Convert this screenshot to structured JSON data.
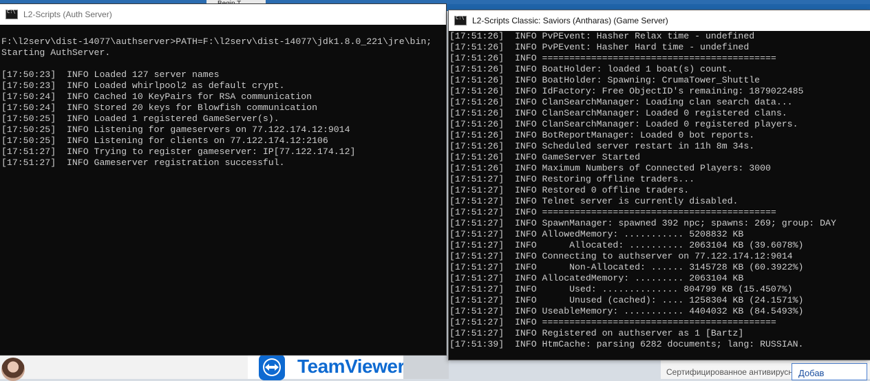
{
  "background": {
    "tab_label": "Begin T",
    "teamviewer_name": "TeamViewer",
    "antivirus_caption": "Сертифицированное антивирусное решение",
    "antivirus_button": "Добав"
  },
  "auth_window": {
    "title": "L2-Scripts (Auth Server)",
    "header_lines": [
      "F:\\l2serv\\dist-14077\\authserver>PATH=F:\\l2serv\\dist-14077\\jdk1.8.0_221\\jre\\bin;",
      "Starting AuthServer."
    ],
    "log_lines": [
      "[17:50:23]  INFO Loaded 127 server names",
      "[17:50:23]  INFO Loaded whirlpool2 as default crypt.",
      "[17:50:24]  INFO Cached 10 KeyPairs for RSA communication",
      "[17:50:24]  INFO Stored 20 keys for Blowfish communication",
      "[17:50:25]  INFO Loaded 1 registered GameServer(s).",
      "[17:50:25]  INFO Listening for gameservers on 77.122.174.12:9014",
      "[17:50:25]  INFO Listening for clients on 77.122.174.12:2106",
      "[17:51:27]  INFO Trying to register gameserver: IP[77.122.174.12]",
      "[17:51:27]  INFO Gameserver registration successful."
    ]
  },
  "game_window": {
    "title": "L2-Scripts Classic: Saviors (Antharas) (Game Server)",
    "log_lines": [
      "[17:51:26]  INFO PvPEvent: Hasher Relax time - undefined",
      "[17:51:26]  INFO PvPEvent: Hasher Hard time - undefined",
      "[17:51:26]  INFO ===========================================",
      "[17:51:26]  INFO BoatHolder: loaded 1 boat(s) count.",
      "[17:51:26]  INFO BoatHolder: Spawning: CrumaTower_Shuttle",
      "[17:51:26]  INFO IdFactory: Free ObjectID's remaining: 1879022485",
      "[17:51:26]  INFO ClanSearchManager: Loading clan search data...",
      "[17:51:26]  INFO ClanSearchManager: Loaded 0 registered clans.",
      "[17:51:26]  INFO ClanSearchManager: Loaded 0 registered players.",
      "[17:51:26]  INFO BotReportManager: Loaded 0 bot reports.",
      "[17:51:26]  INFO Scheduled server restart in 11h 8m 34s.",
      "[17:51:26]  INFO GameServer Started",
      "[17:51:26]  INFO Maximum Numbers of Connected Players: 3000",
      "[17:51:27]  INFO Restoring offline traders...",
      "[17:51:27]  INFO Restored 0 offline traders.",
      "[17:51:27]  INFO Telnet server is currently disabled.",
      "[17:51:27]  INFO ===========================================",
      "[17:51:27]  INFO SpawnManager: spawned 392 npc; spawns: 269; group: DAY",
      "[17:51:27]  INFO AllowedMemory: ........... 5208832 KB",
      "[17:51:27]  INFO      Allocated: .......... 2063104 KB (39.6078%)",
      "[17:51:27]  INFO Connecting to authserver on 77.122.174.12:9014",
      "[17:51:27]  INFO      Non-Allocated: ...... 3145728 KB (60.3922%)",
      "[17:51:27]  INFO AllocatedMemory: ......... 2063104 KB",
      "[17:51:27]  INFO      Used: .............. 804799 KB (15.4507%)",
      "[17:51:27]  INFO      Unused (cached): .... 1258304 KB (24.1571%)",
      "[17:51:27]  INFO UseableMemory: ........... 4404032 KB (84.5493%)",
      "[17:51:27]  INFO ===========================================",
      "[17:51:27]  INFO Registered on authserver as 1 [Bartz]",
      "[17:51:39]  INFO HtmCache: parsing 6282 documents; lang: RUSSIAN."
    ]
  }
}
